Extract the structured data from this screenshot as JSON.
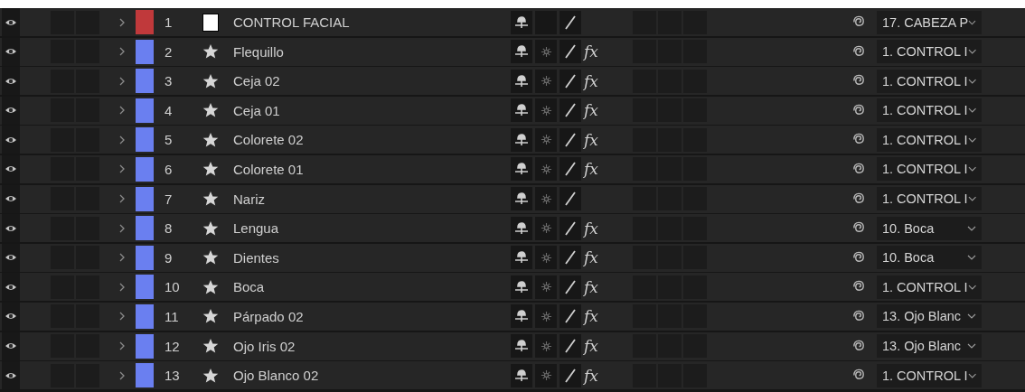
{
  "layers": [
    {
      "number": "1",
      "visible": true,
      "name": "CONTROL FACIAL",
      "color": "#c0393b",
      "kind": "solid",
      "shy": true,
      "collapse_switch": false,
      "quality": true,
      "parent": "17. CABEZA P"
    },
    {
      "number": "2",
      "visible": true,
      "name": "Flequillo",
      "color": "#6a7ff0",
      "kind": "shape",
      "shy": true,
      "collapse_switch": true,
      "quality": true,
      "effects_on": true,
      "fx": "fx",
      "parent": "1. CONTROL I"
    },
    {
      "number": "3",
      "visible": true,
      "name": "Ceja 02",
      "color": "#6a7ff0",
      "kind": "shape",
      "shy": true,
      "collapse_switch": true,
      "quality": true,
      "effects_on": true,
      "fx": "fx",
      "parent": "1. CONTROL I"
    },
    {
      "number": "4",
      "visible": true,
      "name": "Ceja 01",
      "color": "#6a7ff0",
      "kind": "shape",
      "shy": true,
      "collapse_switch": true,
      "quality": true,
      "effects_on": true,
      "fx": "fx",
      "parent": "1. CONTROL I"
    },
    {
      "number": "5",
      "visible": true,
      "name": "Colorete 02",
      "color": "#6a7ff0",
      "kind": "shape",
      "shy": true,
      "collapse_switch": true,
      "quality": true,
      "effects_on": true,
      "fx": "fx",
      "parent": "1. CONTROL I"
    },
    {
      "number": "6",
      "visible": true,
      "name": "Colorete 01",
      "color": "#6a7ff0",
      "kind": "shape",
      "shy": true,
      "collapse_switch": true,
      "quality": true,
      "effects_on": true,
      "fx": "fx",
      "parent": "1. CONTROL I"
    },
    {
      "number": "7",
      "visible": true,
      "name": "Nariz",
      "color": "#6a7ff0",
      "kind": "shape",
      "shy": true,
      "collapse_switch": true,
      "quality": true,
      "parent": "1. CONTROL I"
    },
    {
      "number": "8",
      "visible": true,
      "name": "Lengua",
      "color": "#6a7ff0",
      "kind": "shape",
      "shy": true,
      "collapse_switch": true,
      "quality": true,
      "effects_on": true,
      "fx": "fx",
      "parent": "10. Boca"
    },
    {
      "number": "9",
      "visible": true,
      "name": "Dientes",
      "color": "#6a7ff0",
      "kind": "shape",
      "shy": true,
      "collapse_switch": true,
      "quality": true,
      "effects_on": true,
      "fx": "fx",
      "parent": "10. Boca"
    },
    {
      "number": "10",
      "visible": true,
      "name": "Boca",
      "color": "#6a7ff0",
      "kind": "shape",
      "shy": true,
      "collapse_switch": true,
      "quality": true,
      "effects_on": true,
      "fx": "fx",
      "parent": "1. CONTROL I"
    },
    {
      "number": "11",
      "visible": true,
      "name": "Párpado 02",
      "color": "#6a7ff0",
      "kind": "shape",
      "shy": true,
      "collapse_switch": true,
      "quality": true,
      "effects_on": true,
      "fx": "fx",
      "parent": "13. Ojo Blanc"
    },
    {
      "number": "12",
      "visible": true,
      "name": "Ojo Iris 02",
      "color": "#6a7ff0",
      "kind": "shape",
      "shy": true,
      "collapse_switch": true,
      "quality": true,
      "effects_on": true,
      "fx": "fx",
      "parent": "13. Ojo Blanc"
    },
    {
      "number": "13",
      "visible": true,
      "name": "Ojo Blanco 02",
      "color": "#6a7ff0",
      "kind": "shape",
      "shy": true,
      "collapse_switch": true,
      "quality": true,
      "effects_on": true,
      "fx": "fx",
      "parent": "1. CONTROL I"
    }
  ]
}
